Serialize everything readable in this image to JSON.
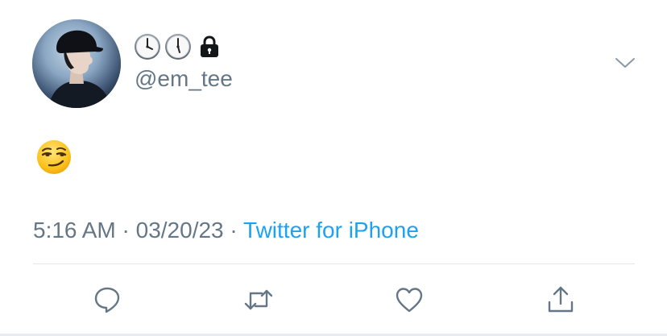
{
  "author": {
    "display_name_icons": [
      "clock-icon",
      "clock-icon",
      "lock-icon"
    ],
    "handle": "@em_tee",
    "avatar": "profile photo of person in black cap"
  },
  "tweet": {
    "content_emoji": "smirking-face-emoji"
  },
  "meta": {
    "time": "5:16 AM",
    "separator": " · ",
    "date": "03/20/23",
    "separator2": " · ",
    "source": "Twitter for iPhone"
  },
  "actions": {
    "icons": [
      "reply-icon",
      "retweet-icon",
      "like-icon",
      "share-icon"
    ]
  },
  "colors": {
    "secondary_text": "#657786",
    "link": "#1da1f2",
    "divider": "#e1e8ed",
    "icon": "#657786"
  }
}
